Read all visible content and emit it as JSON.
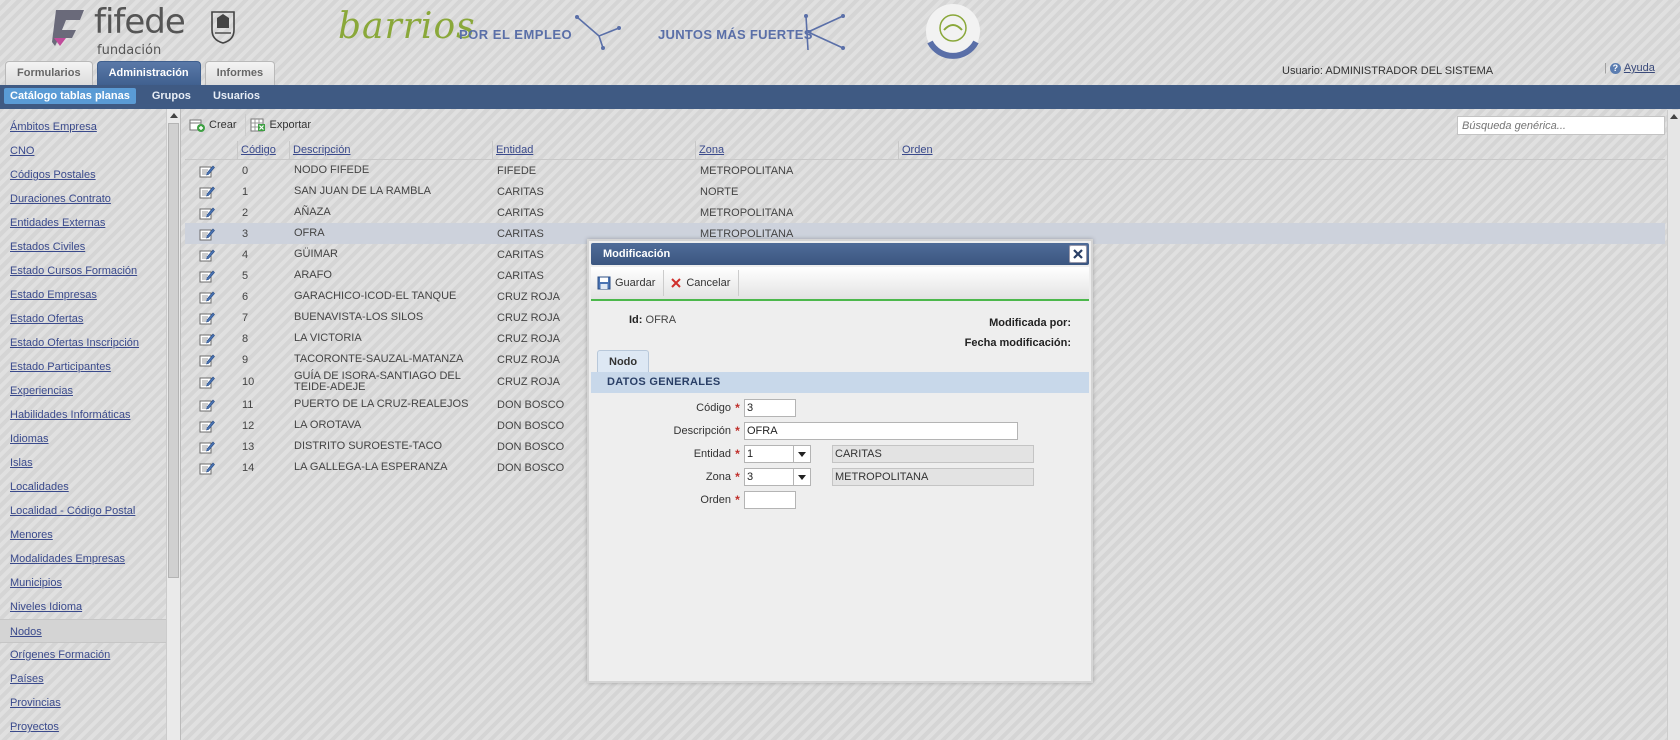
{
  "header": {
    "logo_text": "fifede",
    "logo_subtext": "fundación",
    "barrios_logo_text": "barrios",
    "tagline_1": "POR EL EMPLEO",
    "tagline_2": "JUNTOS MÁS FUERTES",
    "brand_color": "#555555",
    "accent_green": "#8aa83a",
    "tagline_color": "#5a6fa8"
  },
  "main_tabs": [
    {
      "label": "Formularios",
      "active": false
    },
    {
      "label": "Administración",
      "active": true
    },
    {
      "label": "Informes",
      "active": false
    }
  ],
  "user": {
    "text": "Usuario: ADMINISTRADOR DEL SISTEMA"
  },
  "help": {
    "label": "Ayuda",
    "icon": "help-icon"
  },
  "subnav": {
    "items": [
      {
        "label": "Catálogo tablas planas",
        "active": true
      },
      {
        "label": "Grupos",
        "active": false
      },
      {
        "label": "Usuarios",
        "active": false
      }
    ]
  },
  "sidebar": {
    "items": [
      {
        "label": "Ámbitos Empresa"
      },
      {
        "label": "CNO"
      },
      {
        "label": "Códigos Postales"
      },
      {
        "label": "Duraciones Contrato"
      },
      {
        "label": "Entidades Externas"
      },
      {
        "label": "Estados Civiles"
      },
      {
        "label": "Estado Cursos Formación"
      },
      {
        "label": "Estado Empresas"
      },
      {
        "label": "Estado Ofertas"
      },
      {
        "label": "Estado Ofertas Inscripción"
      },
      {
        "label": "Estado Participantes"
      },
      {
        "label": "Experiencias"
      },
      {
        "label": "Habilidades Informáticas"
      },
      {
        "label": "Idiomas"
      },
      {
        "label": "Islas"
      },
      {
        "label": "Localidades"
      },
      {
        "label": "Localidad - Código Postal"
      },
      {
        "label": "Menores"
      },
      {
        "label": "Modalidades Empresas"
      },
      {
        "label": "Municipios"
      },
      {
        "label": "Niveles Idioma"
      },
      {
        "label": "Nodos",
        "active": true
      },
      {
        "label": "Orígenes Formación"
      },
      {
        "label": "Países"
      },
      {
        "label": "Provincias"
      },
      {
        "label": "Proyectos"
      }
    ]
  },
  "toolbar": {
    "create_label": "Crear",
    "export_label": "Exportar",
    "search_placeholder": "Búsqueda genérica..."
  },
  "grid": {
    "columns": [
      "Código",
      "Descripción",
      "Entidad",
      "Zona",
      "Orden"
    ],
    "rows": [
      {
        "codigo": "0",
        "descripcion": "NODO FIFEDE",
        "entidad": "FIFEDE",
        "zona": "METROPOLITANA",
        "orden": ""
      },
      {
        "codigo": "1",
        "descripcion": "SAN JUAN DE LA RAMBLA",
        "entidad": "CARITAS",
        "zona": "NORTE",
        "orden": ""
      },
      {
        "codigo": "2",
        "descripcion": "AÑAZA",
        "entidad": "CARITAS",
        "zona": "METROPOLITANA",
        "orden": ""
      },
      {
        "codigo": "3",
        "descripcion": "OFRA",
        "entidad": "CARITAS",
        "zona": "METROPOLITANA",
        "orden": "",
        "selected": true
      },
      {
        "codigo": "4",
        "descripcion": "GÜIMAR",
        "entidad": "CARITAS",
        "zona": "",
        "orden": ""
      },
      {
        "codigo": "5",
        "descripcion": "ARAFO",
        "entidad": "CARITAS",
        "zona": "",
        "orden": ""
      },
      {
        "codigo": "6",
        "descripcion": "GARACHICO-ICOD-EL TANQUE",
        "entidad": "CRUZ ROJA",
        "zona": "",
        "orden": ""
      },
      {
        "codigo": "7",
        "descripcion": "BUENAVISTA-LOS SILOS",
        "entidad": "CRUZ ROJA",
        "zona": "",
        "orden": ""
      },
      {
        "codigo": "8",
        "descripcion": "LA VICTORIA",
        "entidad": "CRUZ ROJA",
        "zona": "",
        "orden": ""
      },
      {
        "codigo": "9",
        "descripcion": "TACORONTE-SAUZAL-MATANZA",
        "entidad": "CRUZ ROJA",
        "zona": "",
        "orden": ""
      },
      {
        "codigo": "10",
        "descripcion": "GUÍA DE ISORA-SANTIAGO DEL TEIDE-ADEJE",
        "entidad": "CRUZ ROJA",
        "zona": "",
        "orden": "",
        "tall": true
      },
      {
        "codigo": "11",
        "descripcion": "PUERTO DE LA CRUZ-REALEJOS",
        "entidad": "DON BOSCO",
        "zona": "",
        "orden": ""
      },
      {
        "codigo": "12",
        "descripcion": "LA OROTAVA",
        "entidad": "DON BOSCO",
        "zona": "",
        "orden": ""
      },
      {
        "codigo": "13",
        "descripcion": "DISTRITO SUROESTE-TACO",
        "entidad": "DON BOSCO",
        "zona": "",
        "orden": ""
      },
      {
        "codigo": "14",
        "descripcion": "LA GALLEGA-LA ESPERANZA",
        "entidad": "DON BOSCO",
        "zona": "",
        "orden": ""
      }
    ]
  },
  "modal": {
    "title": "Modificación",
    "save_label": "Guardar",
    "cancel_label": "Cancelar",
    "id_label": "Id:",
    "id_value": "OFRA",
    "modified_by_label": "Modificada por:",
    "modified_date_label": "Fecha modificación:",
    "tab_label": "Nodo",
    "section_title": "DATOS GENERALES",
    "required_mark": "*",
    "fields": {
      "codigo": {
        "label": "Código",
        "value": "3"
      },
      "descripcion": {
        "label": "Descripción",
        "value": "OFRA"
      },
      "entidad": {
        "label": "Entidad",
        "value": "1",
        "display": "CARITAS"
      },
      "zona": {
        "label": "Zona",
        "value": "3",
        "display": "METROPOLITANA"
      },
      "orden": {
        "label": "Orden",
        "value": ""
      }
    },
    "header_color": "#3f5a83",
    "accent_green": "#4cb84c",
    "required_color": "#c0302c"
  }
}
